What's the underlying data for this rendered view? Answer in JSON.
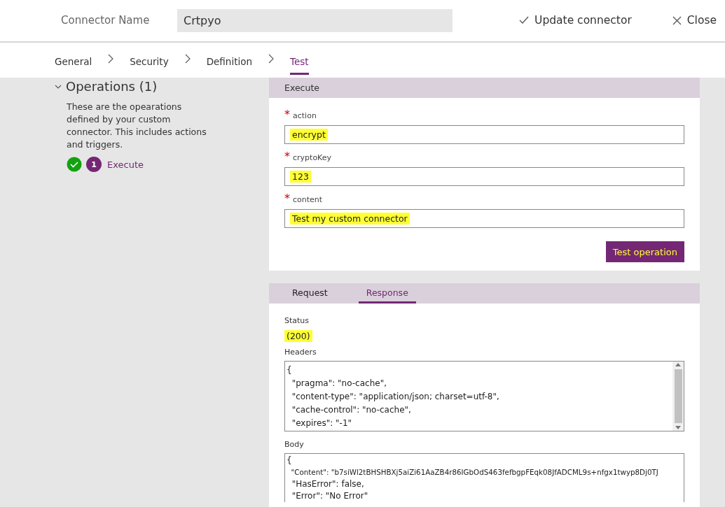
{
  "header": {
    "name_label": "Connector Name",
    "name_value": "Crtpyo",
    "update_button": "Update connector",
    "close_button": "Close"
  },
  "steps": [
    {
      "label": "General",
      "selected": false
    },
    {
      "label": "Security",
      "selected": false
    },
    {
      "label": "Definition",
      "selected": false
    },
    {
      "label": "Test",
      "selected": true
    }
  ],
  "sidebar": {
    "title": "Operations (1)",
    "expanded": true,
    "description": "These are the opearations defined by your custom connector. This includes actions and triggers.",
    "operations": [
      {
        "number": "1",
        "label": "Execute",
        "tested": true
      }
    ]
  },
  "execute": {
    "title": "Execute",
    "fields": [
      {
        "required_mark": "*",
        "label": "action",
        "value": "encrypt",
        "highlighted": true
      },
      {
        "required_mark": "*",
        "label": "cryptoKey",
        "value": "123",
        "highlighted": true
      },
      {
        "required_mark": "*",
        "label": "content",
        "value": "Test my custom connector",
        "highlighted": true
      }
    ],
    "button": "Test operation"
  },
  "result": {
    "tabs": [
      {
        "label": "Request",
        "selected": false
      },
      {
        "label": "Response",
        "selected": true
      }
    ],
    "status_label": "Status",
    "status": "(200)",
    "headers_label": "Headers",
    "headers": [
      "{",
      "  \"pragma\": \"no-cache\",",
      "  \"content-type\": \"application/json; charset=utf-8\",",
      "  \"cache-control\": \"no-cache\",",
      "  \"expires\": \"-1\""
    ],
    "body_label": "Body",
    "body": [
      "{",
      "  \"Content\": \"b7siWl2tBHSHBXj5aiZi61AaZB4r86IGbOdS463fefbgpFEqk08JfADCML9s+nfgx1twyp8Dj0TJ",
      "  \"HasError\": false,",
      "  \"Error\": \"No Error\""
    ]
  }
}
